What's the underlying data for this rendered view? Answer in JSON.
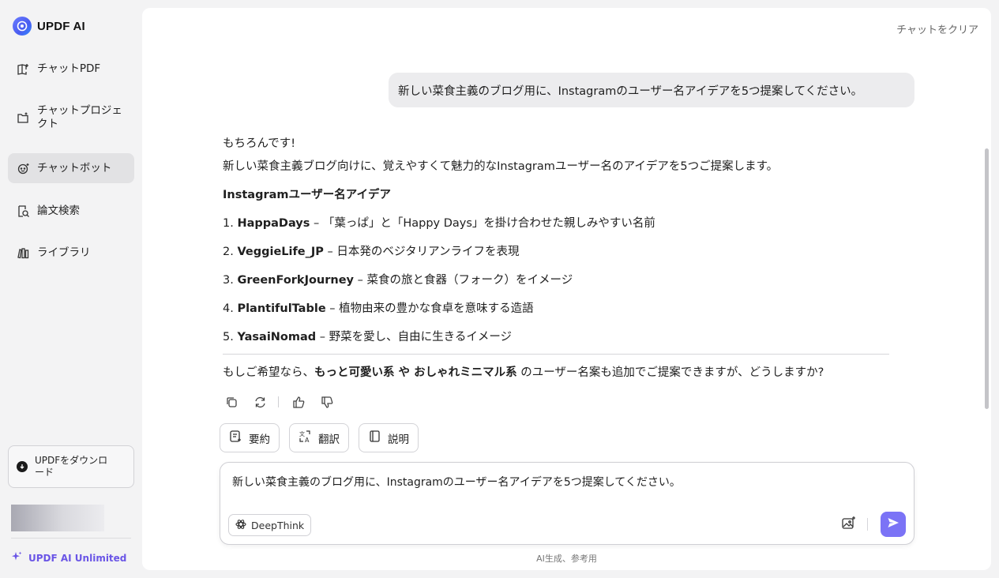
{
  "brand": {
    "name": "UPDF AI"
  },
  "sidebar": {
    "items": [
      {
        "label": "チャットPDF",
        "icon": "book-open-icon",
        "active": false
      },
      {
        "label": "チャットプロジェクト",
        "icon": "folder-icon",
        "active": false
      },
      {
        "label": "チャットボット",
        "icon": "bot-icon",
        "active": true
      },
      {
        "label": "論文検索",
        "icon": "paper-search-icon",
        "active": false
      },
      {
        "label": "ライブラリ",
        "icon": "library-icon",
        "active": false
      }
    ],
    "download_label": "UPDFをダウンロード",
    "plan_label": "UPDF AI Unlimited"
  },
  "header": {
    "clear_chat": "チャットをクリア"
  },
  "chat": {
    "user_message": "新しい菜食主義のブログ用に、Instagramのユーザー名アイデアを5つ提案してください。",
    "answer": {
      "greeting": "もちろんです!",
      "intro": "新しい菜食主義ブログ向けに、覚えやすくて魅力的なInstagramユーザー名のアイデアを5つご提案します。",
      "heading": "Instagramユーザー名アイデア",
      "items": [
        {
          "num": "1.",
          "name": "HappaDays",
          "desc": " – 「葉っぱ」と「Happy Days」を掛け合わせた親しみやすい名前"
        },
        {
          "num": "2.",
          "name": "VeggieLife_JP",
          "desc": " – 日本発のベジタリアンライフを表現"
        },
        {
          "num": "3.",
          "name": "GreenForkJourney",
          "desc": " – 菜食の旅と食器（フォーク）をイメージ"
        },
        {
          "num": "4.",
          "name": "PlantifulTable",
          "desc": " – 植物由来の豊かな食卓を意味する造語"
        },
        {
          "num": "5.",
          "name": "YasaiNomad",
          "desc": " – 野菜を愛し、自由に生きるイメージ"
        }
      ],
      "closing_pre": "もしご希望なら、",
      "closing_b1": "もっと可愛い系",
      "closing_mid": " や ",
      "closing_b2": "おしゃれ",
      "closing_b3": "ミニマル系",
      "closing_post": " のユーザー名案も追加でご提案できますが、どうしますか?"
    }
  },
  "quick_actions": [
    {
      "label": "要約",
      "icon": "summarize-icon"
    },
    {
      "label": "翻訳",
      "icon": "translate-icon"
    },
    {
      "label": "説明",
      "icon": "explain-book-icon"
    }
  ],
  "composer": {
    "value": "新しい菜食主義のブログ用に、Instagramのユーザー名アイデアを5つ提案してください。",
    "deepthink_label": "DeepThink"
  },
  "footer": {
    "disclaimer": "AI生成、参考用"
  },
  "colors": {
    "accent": "#7b73f6",
    "plan": "#6a55e6",
    "active_nav": "#e2e2e4"
  }
}
